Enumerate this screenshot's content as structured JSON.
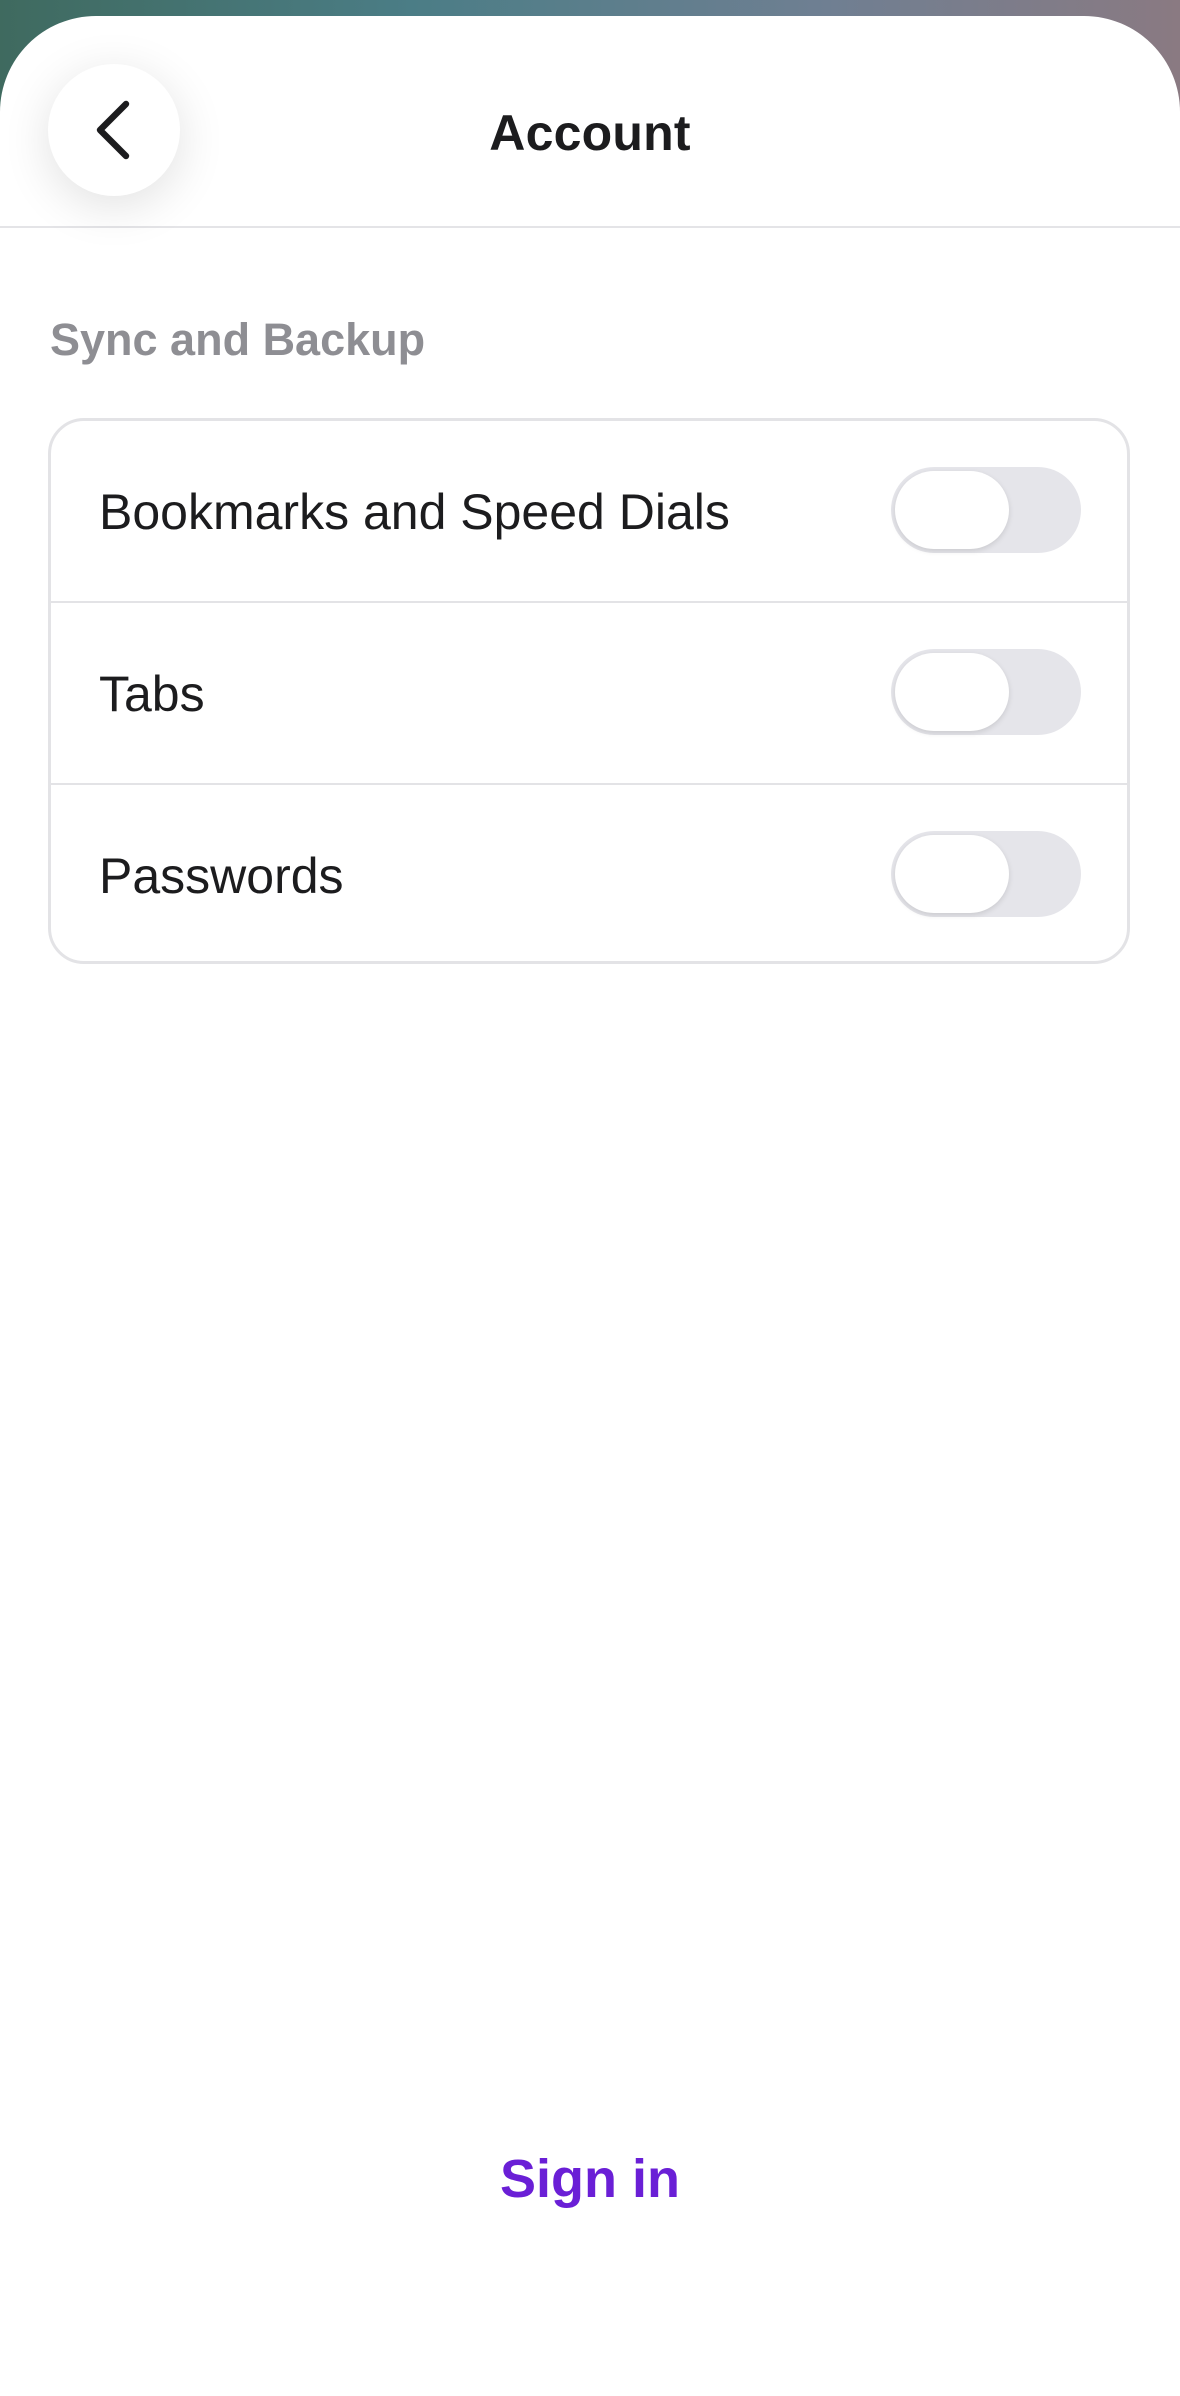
{
  "header": {
    "title": "Account",
    "back_icon": "chevron-left-icon"
  },
  "section": {
    "title": "Sync and Backup",
    "items": [
      {
        "label": "Bookmarks and Speed Dials",
        "enabled": false
      },
      {
        "label": "Tabs",
        "enabled": false
      },
      {
        "label": "Passwords",
        "enabled": false
      }
    ]
  },
  "footer": {
    "sign_in_label": "Sign in"
  },
  "colors": {
    "accent": "#6a1fd6",
    "section_header": "#8e8e93",
    "toggle_off": "#e5e5ea"
  }
}
